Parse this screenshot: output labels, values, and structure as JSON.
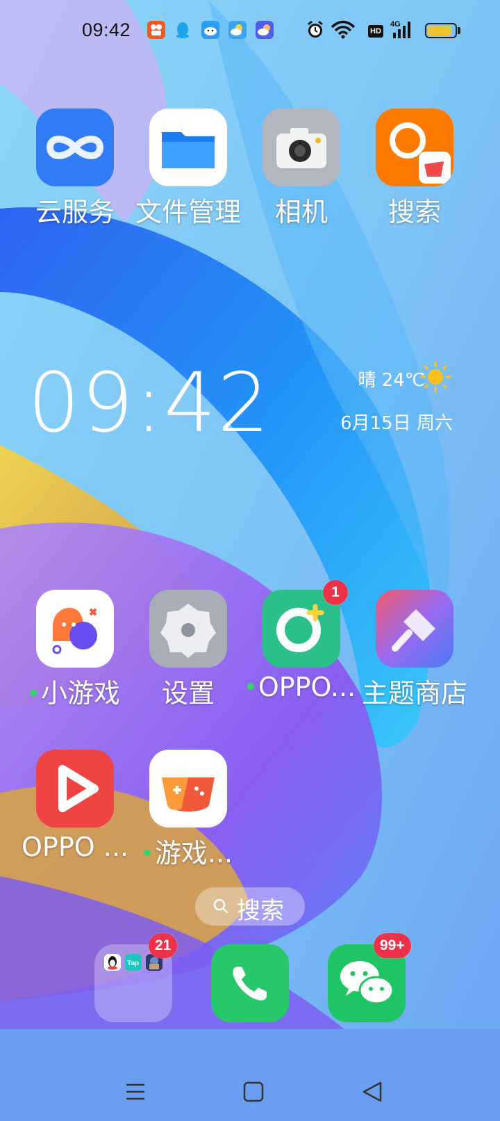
{
  "status_bar": {
    "time": "09:42",
    "notification_icons": [
      "video-app-icon",
      "qq-icon",
      "cloud-mascot-icon",
      "weather-icon",
      "weather-night-icon"
    ],
    "right_icons": [
      "alarm-icon",
      "wifi-icon",
      "hd-icon",
      "signal-4g-icon",
      "battery-icon"
    ],
    "hd_text": "HD",
    "network": "4G",
    "battery_level": 0.9,
    "battery_color": "#f2c230"
  },
  "apps": {
    "cloud": "云服务",
    "files": "文件管理",
    "camera": "相机",
    "search": "搜索",
    "minigames": "小游戏",
    "settings": "设置",
    "oppo_plus": "OPPO...",
    "themes": "主题商店",
    "oppo_video": "OPPO ...",
    "game_center": "游戏..."
  },
  "badges": {
    "oppo_plus": "1",
    "folder": "21",
    "wechat": "99+"
  },
  "widget": {
    "time": "09:42",
    "weather": "晴 24℃",
    "date": "6月15日  周六"
  },
  "search_pill": {
    "label": "搜索"
  },
  "dock": [
    "folder",
    "phone",
    "wechat"
  ],
  "nav": [
    "menu-icon",
    "home-icon",
    "back-icon"
  ],
  "colors": {
    "badge": "#f0314a",
    "new_dot": "#38d16a",
    "phone": "#27c86a",
    "wechat": "#1fc464"
  }
}
